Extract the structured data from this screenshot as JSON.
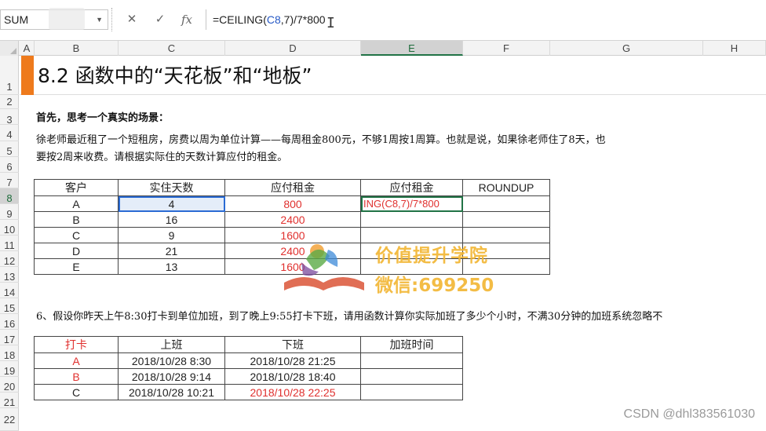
{
  "formula_bar": {
    "name_box": "SUM",
    "cancel_icon": "✕",
    "enter_icon": "✓",
    "fx_label": "fx",
    "formula_prefix": "=CEILING(",
    "formula_ref": "C8",
    "formula_suffix": ",7)/7*800"
  },
  "columns": [
    "A",
    "B",
    "C",
    "D",
    "E",
    "F",
    "G",
    "H"
  ],
  "rows": [
    "1",
    "2",
    "3",
    "4",
    "5",
    "6",
    "7",
    "8",
    "9",
    "10",
    "11",
    "12",
    "13",
    "14",
    "15",
    "16",
    "17",
    "18",
    "19",
    "20",
    "21",
    "22"
  ],
  "title": "8.2 函数中的“天花板”和“地板”",
  "intro": {
    "heading": "首先，思考一个真实的场景：",
    "line1": "徐老师最近租了一个短租房，房费以周为单位计算——每周租金800元，不够1周按1周算。也就是说，如果徐老师住了8天，也",
    "line2": "要按2周来收费。请根据实际住的天数计算应付的租金。"
  },
  "table1": {
    "headers": [
      "客户",
      "实住天数",
      "应付租金",
      "应付租金",
      "ROUNDUP"
    ],
    "rows": [
      {
        "customer": "A",
        "days": "4",
        "rent": "800",
        "formula": "ING(C8,7)/7*800"
      },
      {
        "customer": "B",
        "days": "16",
        "rent": "2400",
        "formula": ""
      },
      {
        "customer": "C",
        "days": "9",
        "rent": "1600",
        "formula": ""
      },
      {
        "customer": "D",
        "days": "21",
        "rent": "2400",
        "formula": ""
      },
      {
        "customer": "E",
        "days": "13",
        "rent": "1600",
        "formula": ""
      }
    ]
  },
  "question6": "6、假设你昨天上午8:30打卡到单位加班，到了晚上9:55打卡下班，请用函数计算你实际加班了多少个小时，不满30分钟的加班系统忽略不",
  "table2": {
    "headers": [
      "打卡",
      "上班",
      "下班",
      "加班时间"
    ],
    "rows": [
      {
        "name": "A",
        "start": "2018/10/28 8:30",
        "end": "2018/10/28 21:25"
      },
      {
        "name": "B",
        "start": "2018/10/28  9:14",
        "end": "2018/10/28 18:40"
      },
      {
        "name": "C",
        "start": "2018/10/28 10:21",
        "end": "2018/10/28 22:25"
      }
    ]
  },
  "watermark": {
    "line1": "价值提升学院",
    "line2": "微信:699250"
  },
  "credit": "CSDN @dhl383561030",
  "colors": {
    "accent": "#ee7a1c",
    "excel_green": "#217346",
    "red": "#e0302e",
    "watermark": "#f2b531"
  }
}
